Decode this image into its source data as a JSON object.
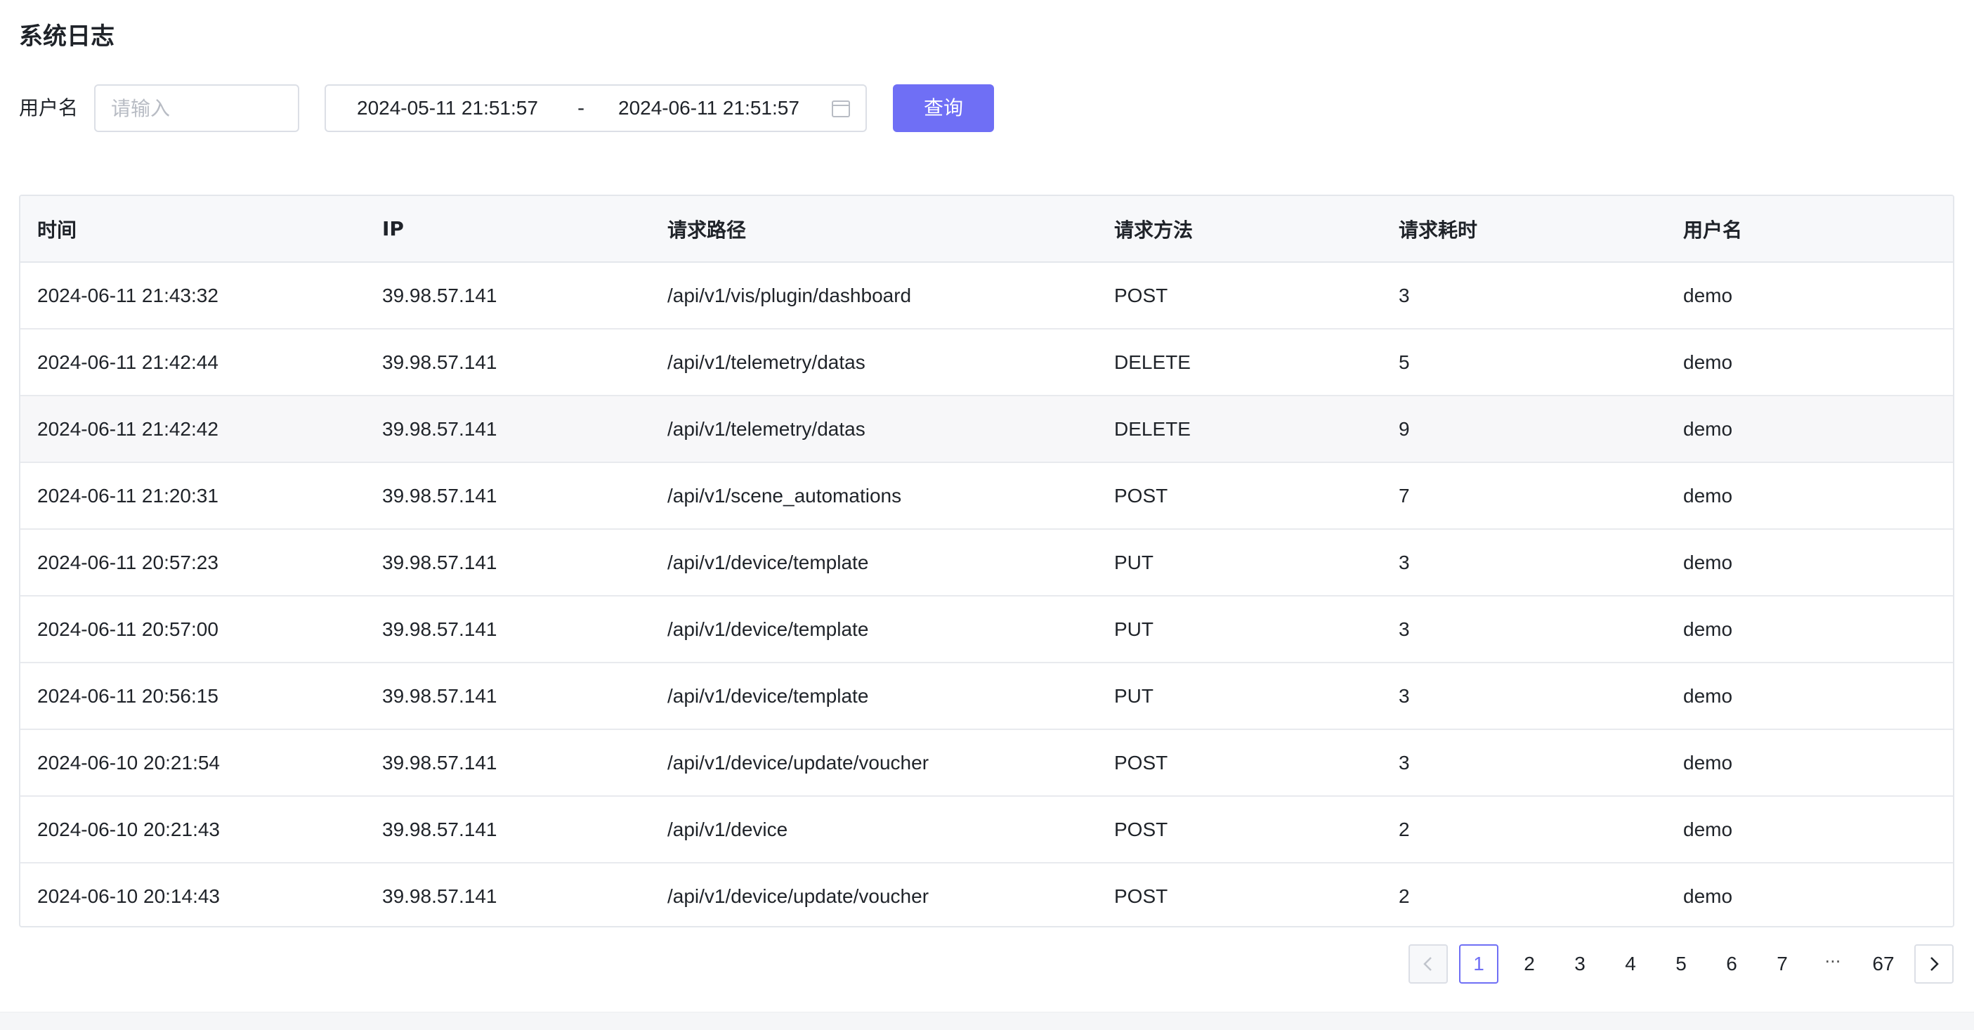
{
  "page": {
    "title": "系统日志"
  },
  "filters": {
    "username_label": "用户名",
    "username_placeholder": "请输入",
    "username_value": "",
    "date_start": "2024-05-11 21:51:57",
    "date_separator": "-",
    "date_end": "2024-06-11 21:51:57",
    "query_label": "查询"
  },
  "table": {
    "headers": [
      "时间",
      "IP",
      "请求路径",
      "请求方法",
      "请求耗时",
      "用户名"
    ],
    "rows": [
      [
        "2024-06-11 21:43:32",
        "39.98.57.141",
        "/api/v1/vis/plugin/dashboard",
        "POST",
        "3",
        "demo"
      ],
      [
        "2024-06-11 21:42:44",
        "39.98.57.141",
        "/api/v1/telemetry/datas",
        "DELETE",
        "5",
        "demo"
      ],
      [
        "2024-06-11 21:42:42",
        "39.98.57.141",
        "/api/v1/telemetry/datas",
        "DELETE",
        "9",
        "demo"
      ],
      [
        "2024-06-11 21:20:31",
        "39.98.57.141",
        "/api/v1/scene_automations",
        "POST",
        "7",
        "demo"
      ],
      [
        "2024-06-11 20:57:23",
        "39.98.57.141",
        "/api/v1/device/template",
        "PUT",
        "3",
        "demo"
      ],
      [
        "2024-06-11 20:57:00",
        "39.98.57.141",
        "/api/v1/device/template",
        "PUT",
        "3",
        "demo"
      ],
      [
        "2024-06-11 20:56:15",
        "39.98.57.141",
        "/api/v1/device/template",
        "PUT",
        "3",
        "demo"
      ],
      [
        "2024-06-10 20:21:54",
        "39.98.57.141",
        "/api/v1/device/update/voucher",
        "POST",
        "3",
        "demo"
      ],
      [
        "2024-06-10 20:21:43",
        "39.98.57.141",
        "/api/v1/device",
        "POST",
        "2",
        "demo"
      ],
      [
        "2024-06-10 20:14:43",
        "39.98.57.141",
        "/api/v1/device/update/voucher",
        "POST",
        "2",
        "demo"
      ]
    ]
  },
  "pagination": {
    "pages": [
      "1",
      "2",
      "3",
      "4",
      "5",
      "6",
      "7"
    ],
    "current": "1",
    "ellipsis": "···",
    "last": "67",
    "prev_icon": "chevron-left-icon",
    "next_icon": "chevron-right-icon"
  },
  "colors": {
    "primary": "#6f6ff5",
    "border": "#dcdfe6",
    "header_bg": "#f7f8fa"
  }
}
